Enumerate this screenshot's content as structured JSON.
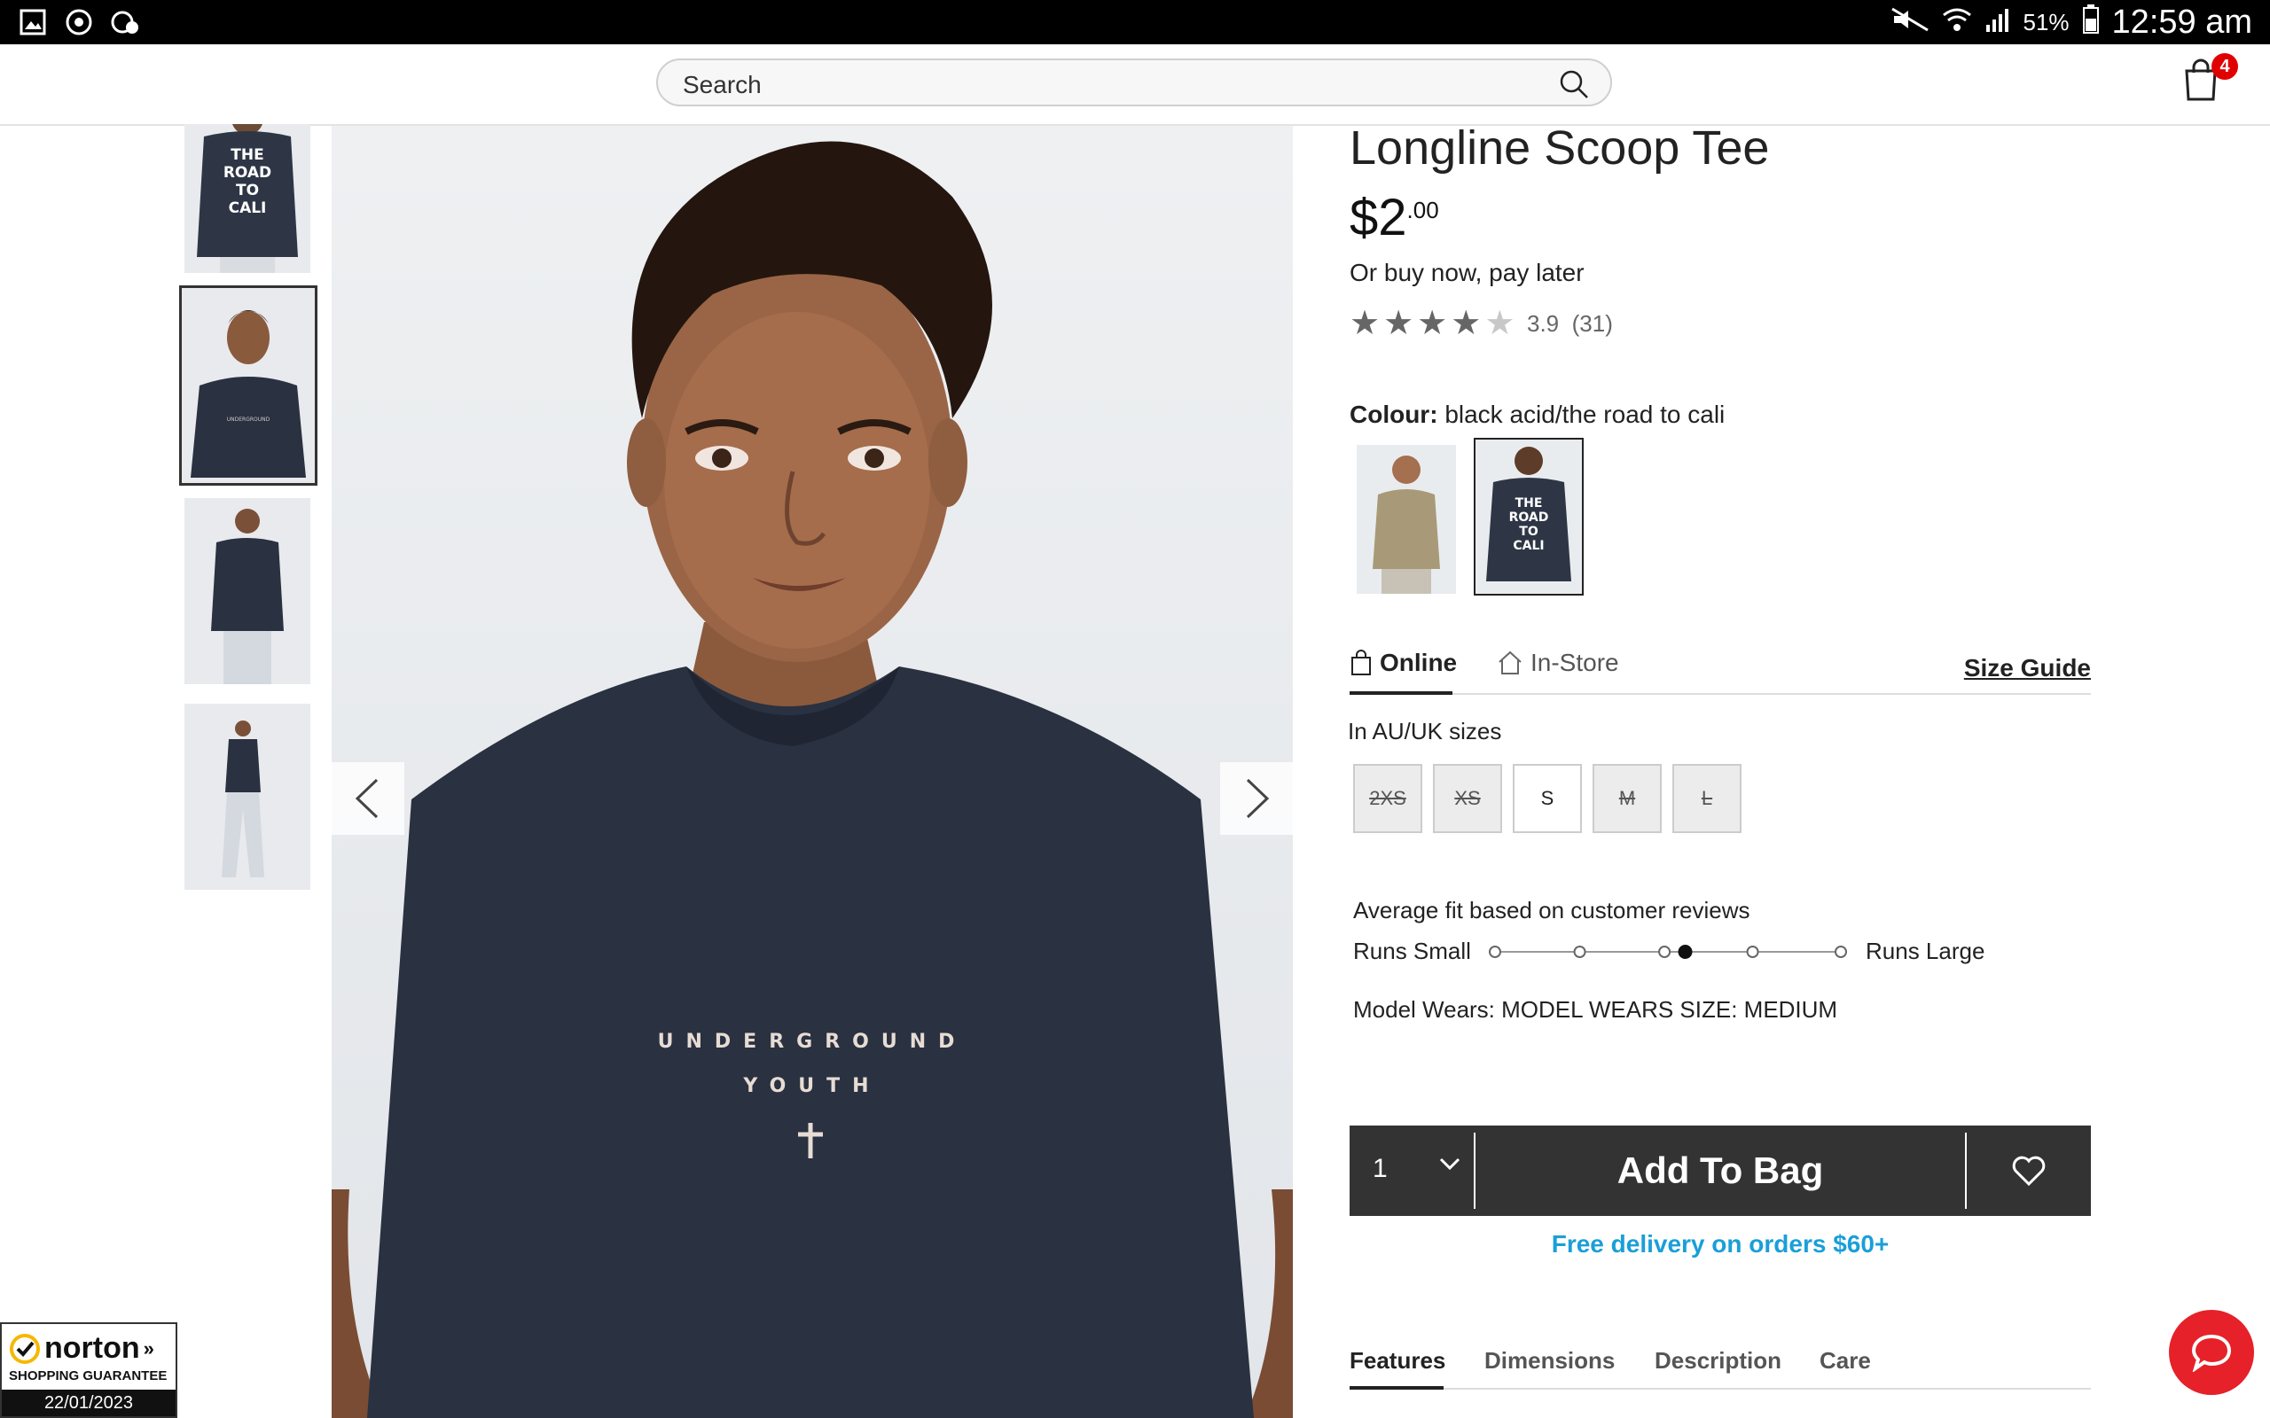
{
  "status_bar": {
    "battery": "51%",
    "time": "12:59 am"
  },
  "header": {
    "search_placeholder": "Search",
    "cart_count": "4"
  },
  "product": {
    "title": "Longline Scoop Tee",
    "price_main": "$2",
    "price_cents": ".00",
    "bnpl": "Or buy now, pay later",
    "rating": "3.9",
    "review_count": "(31)",
    "rating_value": 3.9,
    "stars_max": 5,
    "colour_label": "Colour:",
    "colour_value": "black acid/the road to cali",
    "swatch_shirt_text": [
      "THE",
      "ROAD",
      "TO",
      "CALI"
    ],
    "tee_print": [
      "UNDERGROUND",
      "YOUTH"
    ]
  },
  "availability_tabs": {
    "online": "Online",
    "in_store": "In-Store",
    "size_guide": "Size Guide"
  },
  "sizes": {
    "label": "In AU/UK sizes",
    "items": [
      {
        "label": "2XS",
        "available": false
      },
      {
        "label": "XS",
        "available": false
      },
      {
        "label": "S",
        "available": true
      },
      {
        "label": "M",
        "available": false
      },
      {
        "label": "L",
        "available": false
      }
    ]
  },
  "fit": {
    "title": "Average fit based on customer reviews",
    "small": "Runs Small",
    "large": "Runs Large",
    "selected_step": 4,
    "steps": 7
  },
  "model_wears": "Model Wears: MODEL WEARS SIZE: MEDIUM",
  "cart": {
    "qty": "1",
    "add_to_bag": "Add To Bag"
  },
  "free_delivery": "Free delivery on orders $60+",
  "bottom_tabs": [
    "Features",
    "Dimensions",
    "Description",
    "Care"
  ],
  "norton": {
    "brand": "norton",
    "subtitle": "SHOPPING GUARANTEE",
    "date": "22/01/2023"
  },
  "colors": {
    "accent_blue": "#1a9fd8",
    "cart_bar": "#333333",
    "badge_red": "#e10000",
    "chat_red": "#e62129",
    "tee_navy": "#2a3140"
  }
}
